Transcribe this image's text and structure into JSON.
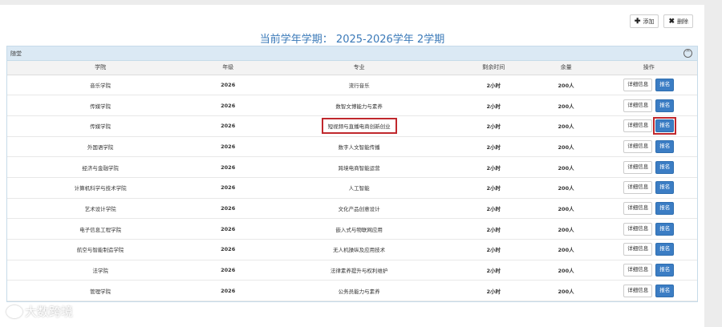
{
  "toolbar": {
    "add_label": "添加",
    "delete_label": "删除"
  },
  "page_title": "当前学年学期： 2025-2026学年 2学期",
  "section": {
    "label": "随堂",
    "collapse_glyph": "^"
  },
  "table": {
    "headers": [
      "学院",
      "年级",
      "专业",
      "剩余时间",
      "余量",
      "操作"
    ],
    "detail_label": "详细信息",
    "apply_label": "报名",
    "rows": [
      {
        "college": "音乐学院",
        "grade": "2026",
        "major": "流行音乐",
        "remaining": "2小时",
        "quota": "200人"
      },
      {
        "college": "传媒学院",
        "grade": "2026",
        "major": "数智文博能力与素养",
        "remaining": "2小时",
        "quota": "200人"
      },
      {
        "college": "传媒学院",
        "grade": "2026",
        "major": "短视频与直播电商创新创业",
        "remaining": "2小时",
        "quota": "200人"
      },
      {
        "college": "外国语学院",
        "grade": "2026",
        "major": "数字人文智能传播",
        "remaining": "2小时",
        "quota": "200人"
      },
      {
        "college": "经济与金融学院",
        "grade": "2026",
        "major": "跨境电商智能运营",
        "remaining": "2小时",
        "quota": "200人"
      },
      {
        "college": "计算机科学与技术学院",
        "grade": "2026",
        "major": "人工智能",
        "remaining": "2小时",
        "quota": "200人"
      },
      {
        "college": "艺术设计学院",
        "grade": "2026",
        "major": "文化产品创意设计",
        "remaining": "2小时",
        "quota": "200人"
      },
      {
        "college": "电子信息工程学院",
        "grade": "2026",
        "major": "嵌入式与物联网应用",
        "remaining": "2小时",
        "quota": "200人"
      },
      {
        "college": "航空与智能制造学院",
        "grade": "2026",
        "major": "无人机操纵及应用技术",
        "remaining": "2小时",
        "quota": "200人"
      },
      {
        "college": "法学院",
        "grade": "2026",
        "major": "法律素养提升与权利维护",
        "remaining": "2小时",
        "quota": "200人"
      },
      {
        "college": "管理学院",
        "grade": "2026",
        "major": "公务员能力与素养",
        "remaining": "2小时",
        "quota": "200人"
      }
    ]
  },
  "watermark": {
    "text": "大数跨境"
  },
  "colors": {
    "title": "#3a79b8",
    "apply_button": "#3b7dc4",
    "highlight": "#c0282d",
    "section_bg": "#dbe9f4"
  }
}
